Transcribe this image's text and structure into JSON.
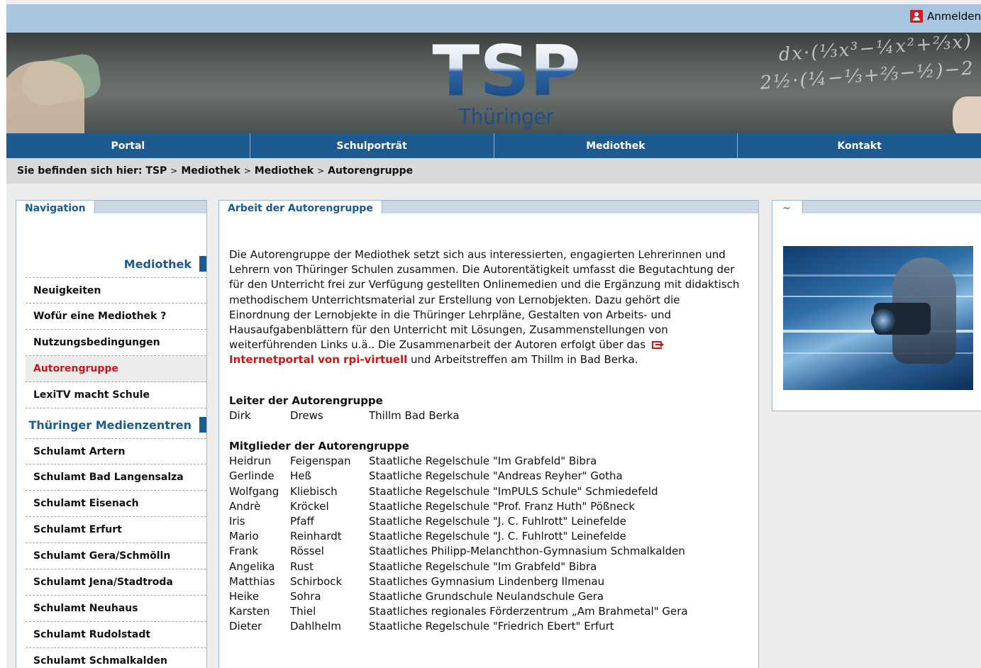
{
  "header": {
    "login_label": "Anmelden",
    "logo_letters": "TSP",
    "logo_text": "Thüringer Schulportal",
    "formula": "dx·(⅓x³−¼x²+⅔x)\n2½·(¼−⅓+⅔−½)−2"
  },
  "mainnav": {
    "tabs": [
      "Portal",
      "Schulporträt",
      "Mediothek",
      "Kontakt"
    ]
  },
  "breadcrumb": {
    "prefix": "Sie befinden sich hier:",
    "items": [
      "TSP",
      "Mediothek",
      "Mediothek",
      "Autorengruppe"
    ],
    "separator": ">"
  },
  "navigation": {
    "title": "Navigation",
    "section1": "Mediothek",
    "section1_items": [
      "Neuigkeiten",
      "Wofür eine Mediothek ?",
      "Nutzungsbedingungen",
      "Autorengruppe",
      "LexiTV macht Schule"
    ],
    "active_item": "Autorengruppe",
    "section2": "Thüringer Medienzentren",
    "section2_items": [
      "Schulamt Artern",
      "Schulamt Bad Langensalza",
      "Schulamt Eisenach",
      "Schulamt Erfurt",
      "Schulamt Gera/Schmölln",
      "Schulamt Jena/Stadtroda",
      "Schulamt Neuhaus",
      "Schulamt Rudolstadt",
      "Schulamt Schmalkalden"
    ]
  },
  "content": {
    "title": "Arbeit der Autorengruppe",
    "intro_lines": [
      "Die Autorengruppe der Mediothek setzt sich aus interessierten, engagierten Lehrerinnen und",
      "Lehrern von Thüringer Schulen zusammen. Die Autorentätigkeit umfasst die Begutachtung der",
      "für den Unterricht frei zur Verfügung gestellten Onlinemedien und die Ergänzung mit didaktisch",
      "methodischem Unterrichtsmaterial zur Erstellung von Lernobjekten. Dazu gehört die",
      "Einordnung der Lernobjekte in die Thüringer Lehrpläne, Gestalten von Arbeits- und",
      "Hausaufgabenblättern für den Unterricht mit Lösungen, Zusammenstellungen von"
    ],
    "intro_line7": "weiterführenden Links u.ä.. Die Zusammenarbeit der Autoren erfolgt über das",
    "link_text": "Internetportal von rpi-virtuell",
    "intro_tail": " und Arbeitstreffen am Thillm in Bad Berka.",
    "leader_heading": "Leiter der Autorengruppe",
    "leader": {
      "first": "Dirk",
      "last": "Drews",
      "org": "Thillm Bad Berka"
    },
    "members_heading": "Mitglieder der Autorengruppe",
    "members": [
      {
        "first": "Heidrun",
        "last": "Feigenspan",
        "org": "Staatliche Regelschule \"Im Grabfeld\" Bibra"
      },
      {
        "first": "Gerlinde",
        "last": "Heß",
        "org": "Staatliche Regelschule \"Andreas Reyher\" Gotha"
      },
      {
        "first": "Wolfgang",
        "last": "Kliebisch",
        "org": "Staatliche Regelschule \"ImPULS Schule\" Schmiedefeld"
      },
      {
        "first": "Andrè",
        "last": "Kröckel",
        "org": "Staatliche Regelschule \"Prof. Franz Huth\" Pößneck"
      },
      {
        "first": "Iris",
        "last": "Pfaff",
        "org": "Staatliche Regelschule \"J. C. Fuhlrott\" Leinefelde"
      },
      {
        "first": "Mario",
        "last": "Reinhardt",
        "org": "Staatliche Regelschule \"J. C. Fuhlrott\" Leinefelde"
      },
      {
        "first": "Frank",
        "last": "Rössel",
        "org": "Staatliches Philipp-Melanchthon-Gymnasium Schmalkalden"
      },
      {
        "first": "Angelika",
        "last": "Rust",
        "org": "Staatliche Regelschule \"Im Grabfeld\" Bibra"
      },
      {
        "first": "Matthias",
        "last": "Schirbock",
        "org": "Staatliches Gymnasium Lindenberg Ilmenau"
      },
      {
        "first": "Heike",
        "last": "Sohra",
        "org": "Staatliche Grundschule Neulandschule Gera"
      },
      {
        "first": "Karsten",
        "last": "Thiel",
        "org": "Staatliches regionales Förderzentrum „Am Brahmetal\" Gera"
      },
      {
        "first": "Dieter",
        "last": "Dahlhelm",
        "org": "Staatliche Regelschule \"Friedrich Ebert\" Erfurt"
      }
    ]
  },
  "sidebox": {
    "title": "~"
  },
  "colors": {
    "nav_blue": "#1c5a8f",
    "active_red": "#cc1616",
    "topbar": "#a9c6e1"
  }
}
